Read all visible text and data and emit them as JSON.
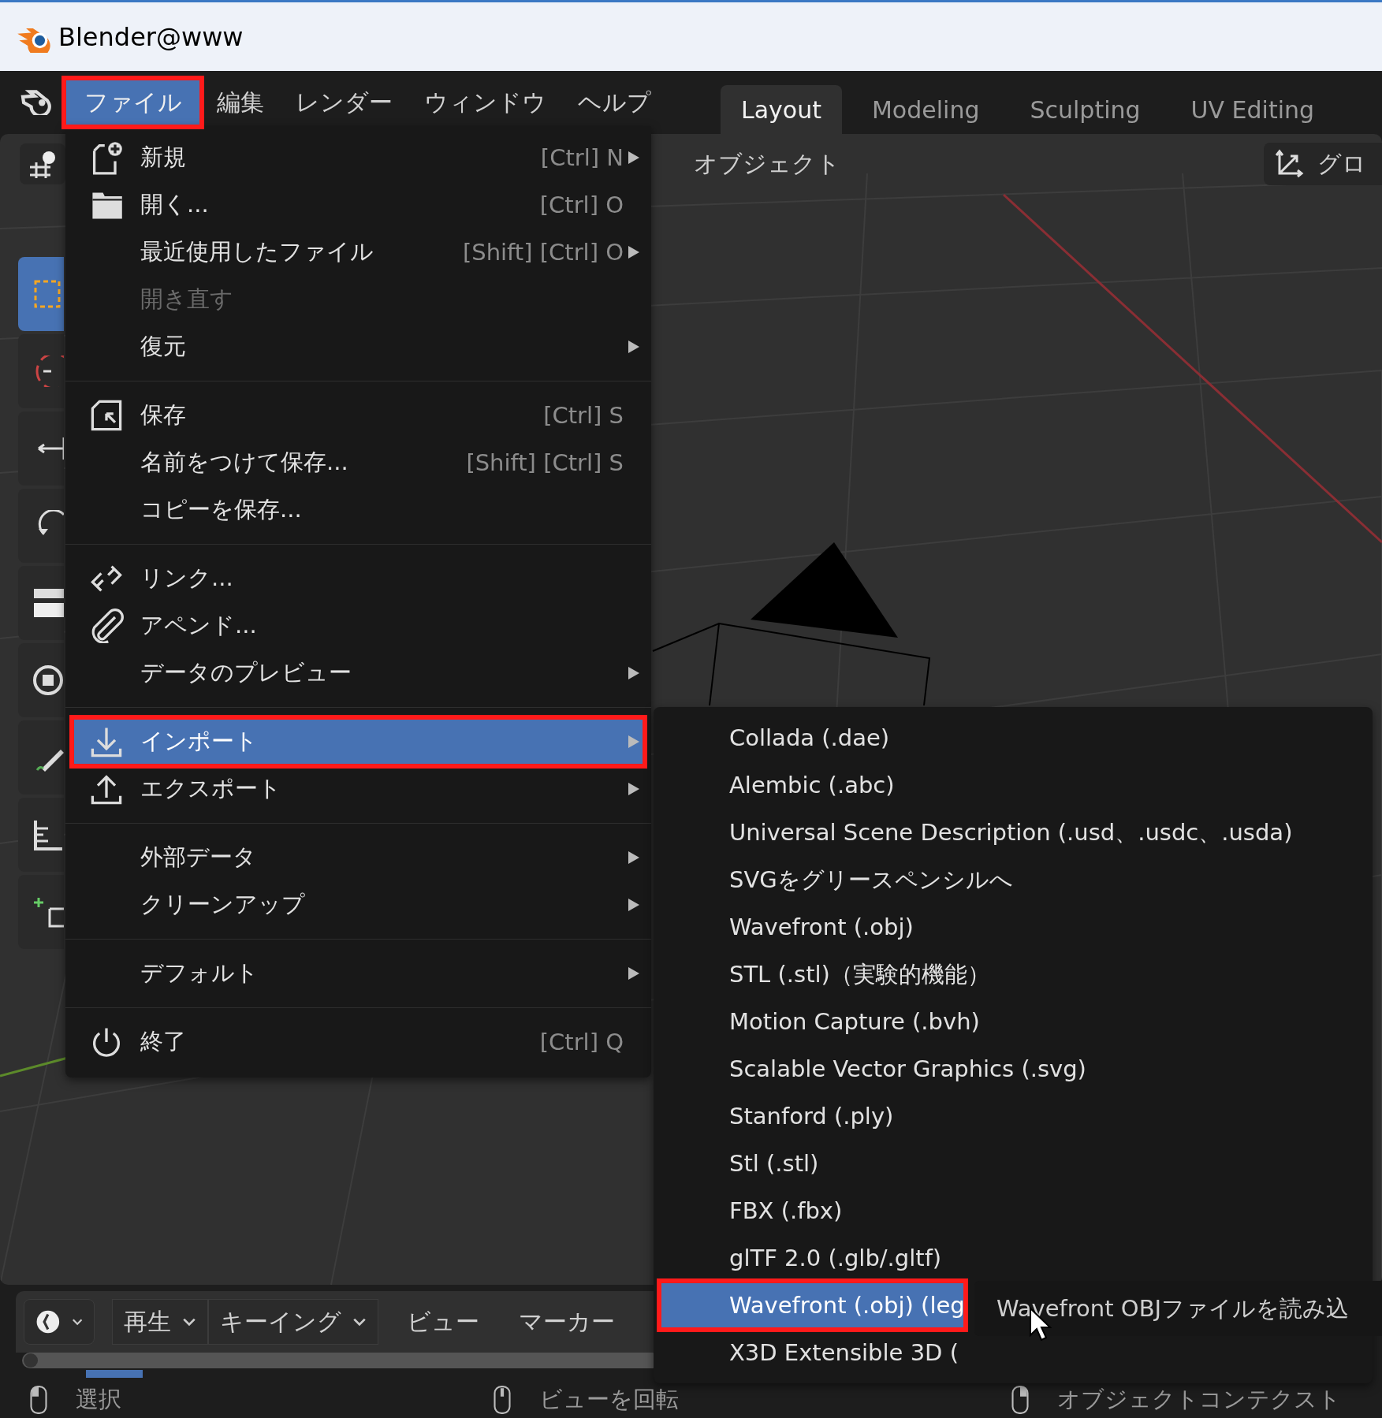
{
  "window": {
    "title": "Blender@www"
  },
  "menubar": [
    {
      "label": "ファイル",
      "selected": true,
      "outlined": true
    },
    {
      "label": "編集",
      "selected": false,
      "outlined": false
    },
    {
      "label": "レンダー",
      "selected": false,
      "outlined": false
    },
    {
      "label": "ウィンドウ",
      "selected": false,
      "outlined": false
    },
    {
      "label": "ヘルプ",
      "selected": false,
      "outlined": false
    }
  ],
  "workspace_tabs": [
    {
      "label": "Layout",
      "selected": true
    },
    {
      "label": "Modeling",
      "selected": false
    },
    {
      "label": "Sculpting",
      "selected": false
    },
    {
      "label": "UV Editing",
      "selected": false
    }
  ],
  "viewport": {
    "object_menu": "オブジェクト",
    "orientation": "グロ"
  },
  "file_menu": [
    [
      {
        "label": "新規",
        "shortcut": "[Ctrl] N",
        "submenu": true,
        "disabled": false,
        "highlighted": false,
        "outlined": false
      },
      {
        "label": "開く...",
        "shortcut": "[Ctrl] O",
        "submenu": false,
        "disabled": false,
        "highlighted": false,
        "outlined": false
      },
      {
        "label": "最近使用したファイル",
        "shortcut": "[Shift] [Ctrl] O",
        "submenu": true,
        "disabled": false,
        "highlighted": false,
        "outlined": false
      },
      {
        "label": "開き直す",
        "submenu": false,
        "disabled": true,
        "highlighted": false,
        "outlined": false
      },
      {
        "label": "復元",
        "submenu": true,
        "disabled": false,
        "highlighted": false,
        "outlined": false
      }
    ],
    [
      {
        "label": "保存",
        "shortcut": "[Ctrl] S",
        "submenu": false,
        "disabled": false,
        "highlighted": false,
        "outlined": false
      },
      {
        "label": "名前をつけて保存...",
        "shortcut": "[Shift] [Ctrl] S",
        "submenu": false,
        "disabled": false,
        "highlighted": false,
        "outlined": false
      },
      {
        "label": "コピーを保存...",
        "submenu": false,
        "disabled": false,
        "highlighted": false,
        "outlined": false
      }
    ],
    [
      {
        "label": "リンク...",
        "submenu": false,
        "disabled": false,
        "highlighted": false,
        "outlined": false
      },
      {
        "label": "アペンド...",
        "submenu": false,
        "disabled": false,
        "highlighted": false,
        "outlined": false
      },
      {
        "label": "データのプレビュー",
        "submenu": true,
        "disabled": false,
        "highlighted": false,
        "outlined": false
      }
    ],
    [
      {
        "label": "インポート",
        "submenu": true,
        "disabled": false,
        "highlighted": true,
        "outlined": true
      },
      {
        "label": "エクスポート",
        "submenu": true,
        "disabled": false,
        "highlighted": false,
        "outlined": false
      }
    ],
    [
      {
        "label": "外部データ",
        "submenu": true,
        "disabled": false,
        "highlighted": false,
        "outlined": false
      },
      {
        "label": "クリーンアップ",
        "submenu": true,
        "disabled": false,
        "highlighted": false,
        "outlined": false
      }
    ],
    [
      {
        "label": "デフォルト",
        "submenu": true,
        "disabled": false,
        "highlighted": false,
        "outlined": false
      }
    ],
    [
      {
        "label": "終了",
        "shortcut": "[Ctrl] Q",
        "submenu": false,
        "disabled": false,
        "highlighted": false,
        "outlined": false
      }
    ]
  ],
  "import_menu": [
    {
      "label": "Collada (.dae)",
      "highlighted": false,
      "outlined": false
    },
    {
      "label": "Alembic (.abc)",
      "highlighted": false,
      "outlined": false
    },
    {
      "label": "Universal Scene Description (.usd、.usdc、.usda)",
      "highlighted": false,
      "outlined": false
    },
    {
      "label": "SVGをグリースペンシルへ",
      "highlighted": false,
      "outlined": false
    },
    {
      "label": "Wavefront (.obj)",
      "highlighted": false,
      "outlined": false
    },
    {
      "label": "STL (.stl)（実験的機能）",
      "highlighted": false,
      "outlined": false
    },
    {
      "label": "Motion Capture (.bvh)",
      "highlighted": false,
      "outlined": false
    },
    {
      "label": "Scalable Vector Graphics (.svg)",
      "highlighted": false,
      "outlined": false
    },
    {
      "label": "Stanford (.ply)",
      "highlighted": false,
      "outlined": false
    },
    {
      "label": "Stl (.stl)",
      "highlighted": false,
      "outlined": false
    },
    {
      "label": "FBX (.fbx)",
      "highlighted": false,
      "outlined": false
    },
    {
      "label": "glTF 2.0 (.glb/.gltf)",
      "highlighted": false,
      "outlined": false
    },
    {
      "label": "Wavefront (.obj) (leg",
      "highlighted": true,
      "outlined": true
    },
    {
      "label": "X3D Extensible 3D (",
      "highlighted": false,
      "outlined": false
    }
  ],
  "tooltip": "Wavefront OBJファイルを読み込",
  "timeline": [
    {
      "kind": "editor"
    },
    {
      "kind": "dropdown",
      "label": "再生"
    },
    {
      "kind": "dropdown",
      "label": "キーイング"
    },
    {
      "kind": "menu",
      "label": "ビュー"
    },
    {
      "kind": "menu",
      "label": "マーカー"
    }
  ],
  "status_bar": [
    {
      "label": "選択"
    },
    {
      "label": "ビューを回転"
    },
    {
      "label": "オブジェクトコンテクスト"
    }
  ]
}
